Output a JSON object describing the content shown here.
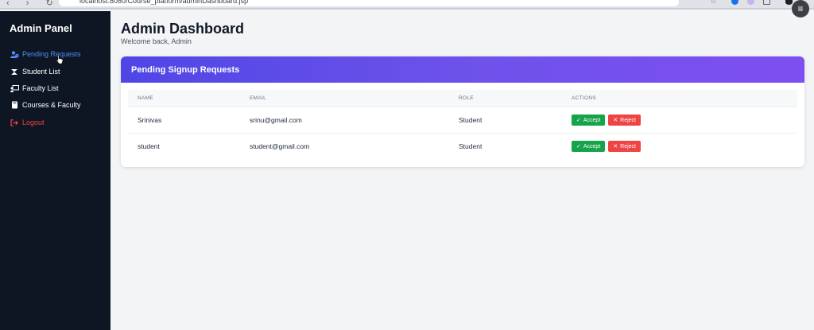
{
  "browser": {
    "url": "localhost:8080/Course_platform/adminDashboard.jsp"
  },
  "sidebar": {
    "brand": "Admin Panel",
    "items": [
      {
        "label": "Pending Requests",
        "icon": "user-clock-icon"
      },
      {
        "label": "Student List",
        "icon": "graduation-cap-icon"
      },
      {
        "label": "Faculty List",
        "icon": "chalkboard-teacher-icon"
      },
      {
        "label": "Courses & Faculty",
        "icon": "book-icon"
      },
      {
        "label": "Logout",
        "icon": "sign-out-icon"
      }
    ],
    "active_index": 0
  },
  "header": {
    "title": "Admin Dashboard",
    "subtitle": "Welcome back, Admin"
  },
  "card": {
    "title": "Pending Signup Requests",
    "columns": [
      "NAME",
      "EMAIL",
      "ROLE",
      "ACTIONS"
    ],
    "rows": [
      {
        "name": "Srinivas",
        "email": "srinu@gmail.com",
        "role": "Student"
      },
      {
        "name": "student",
        "email": "student@gmail.com",
        "role": "Student"
      }
    ],
    "accept_label": "Accept",
    "reject_label": "Reject"
  },
  "colors": {
    "sidebar_bg": "#0f1623",
    "active": "#4f8df7",
    "logout": "#ef4444",
    "header_gradient_start": "#4f46e5",
    "header_gradient_end": "#7e4ff0",
    "accept": "#16a34a",
    "reject": "#ef4444"
  }
}
